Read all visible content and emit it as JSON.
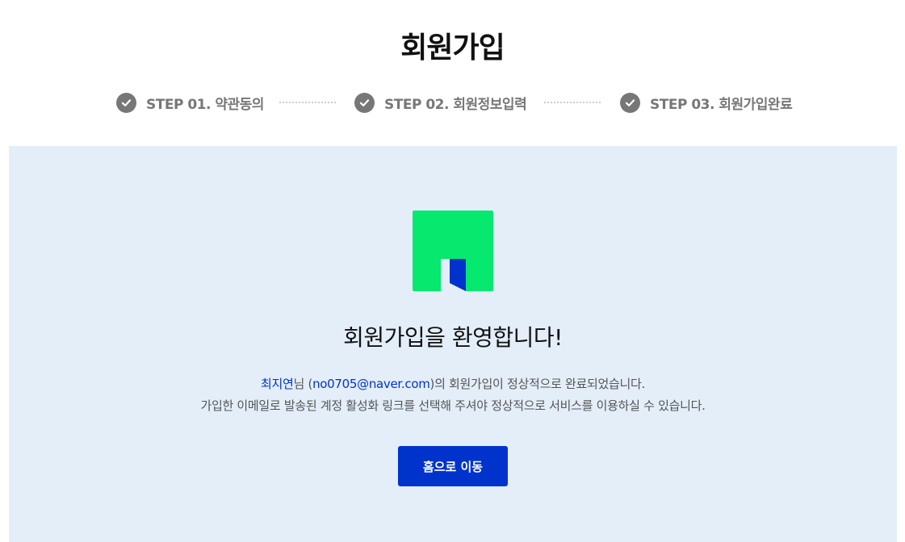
{
  "page_title": "회원가입",
  "steps": [
    {
      "label": "STEP 01. 약관동의"
    },
    {
      "label": "STEP 02. 회원정보입력"
    },
    {
      "label": "STEP 03. 회원가입완료"
    }
  ],
  "welcome_heading": "회원가입을 환영합니다!",
  "message": {
    "user_name": "최지연",
    "name_suffix": "님 (",
    "email": "no0705@naver.com",
    "line1_rest": ")의 회원가입이 정상적으로 완료되었습니다.",
    "line2": "가입한 이메일로 발송된 계정 활성화 링크를 선택해 주셔야 정상적으로 서비스를 이용하실 수 있습니다."
  },
  "home_button_label": "홈으로 이동",
  "icons": {
    "step_check": "check-circle-icon",
    "logo": "brand-logo"
  },
  "colors": {
    "logo_green": "#06e86e",
    "logo_blue": "#0033cc",
    "primary_button": "#0033cc",
    "panel_background": "#e3eef9",
    "step_gray": "#777777"
  }
}
